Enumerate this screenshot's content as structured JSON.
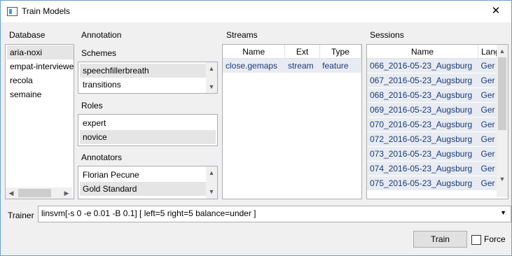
{
  "window": {
    "title": "Train Models",
    "close_glyph": "✕"
  },
  "database": {
    "label": "Database",
    "items": [
      "aria-noxi",
      "empat-interviewe",
      "recola",
      "semaine"
    ],
    "selected_index": 0
  },
  "annotation": {
    "label": "Annotation",
    "schemes_label": "Schemes",
    "schemes": [
      "speechfillerbreath",
      "transitions"
    ],
    "roles_label": "Roles",
    "roles": [
      "expert",
      "novice"
    ],
    "annotators_label": "Annotators",
    "annotators": [
      "Florian Pecune",
      "Gold Standard"
    ]
  },
  "streams": {
    "label": "Streams",
    "columns": [
      "Name",
      "Ext",
      "Type"
    ],
    "rows": [
      [
        "close.gemaps",
        "stream",
        "feature"
      ]
    ]
  },
  "sessions": {
    "label": "Sessions",
    "columns": [
      "Name",
      "Lang"
    ],
    "rows": [
      [
        "066_2016-05-23_Augsburg",
        "Ger"
      ],
      [
        "067_2016-05-23_Augsburg",
        "Ger"
      ],
      [
        "068_2016-05-23_Augsburg",
        "Ger"
      ],
      [
        "069_2016-05-23_Augsburg",
        "Ger"
      ],
      [
        "070_2016-05-23_Augsburg",
        "Ger"
      ],
      [
        "072_2016-05-23_Augsburg",
        "Ger"
      ],
      [
        "073_2016-05-23_Augsburg",
        "Ger"
      ],
      [
        "074_2016-05-23_Augsburg",
        "Ger"
      ],
      [
        "075_2016-05-23_Augsburg",
        "Ger"
      ]
    ]
  },
  "trainer": {
    "label": "Trainer",
    "value": "linsvm[-s 0 -e 0.01 -B 0.1] [ left=5 right=5 balance=under ]"
  },
  "actions": {
    "train_label": "Train",
    "force_label": "Force",
    "force_checked": false
  },
  "glyphs": {
    "up": "▲",
    "down": "▼",
    "left": "◀",
    "right": "▶",
    "dropdown": "▼"
  },
  "colors": {
    "selection": "#e5e5e5",
    "session_row": "#e8ebf1",
    "text_link": "#1a3a7a"
  }
}
